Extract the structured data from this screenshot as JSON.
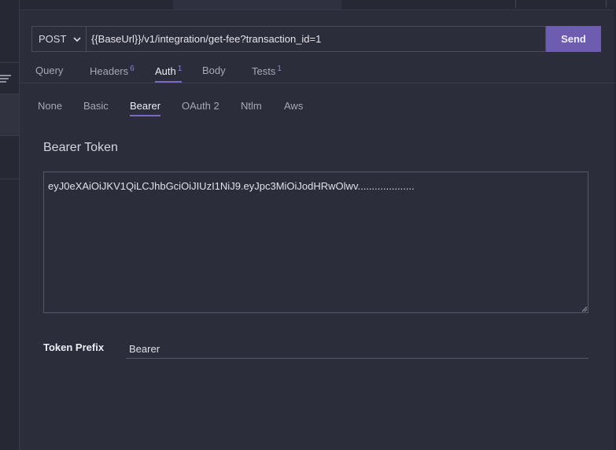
{
  "request": {
    "method": "POST",
    "url": "{{BaseUrl}}/v1/integration/get-fee?transaction_id=1",
    "send_label": "Send"
  },
  "tabs": [
    {
      "label": "Query",
      "count": ""
    },
    {
      "label": "Headers",
      "count": "6"
    },
    {
      "label": "Auth",
      "count": "1"
    },
    {
      "label": "Body",
      "count": ""
    },
    {
      "label": "Tests",
      "count": "1"
    }
  ],
  "active_tab": "Auth",
  "auth_types": [
    "None",
    "Basic",
    "Bearer",
    "OAuth 2",
    "Ntlm",
    "Aws"
  ],
  "active_auth_type": "Bearer",
  "bearer": {
    "title": "Bearer Token",
    "token": "eyJ0eXAiOiJKV1QiLCJhbGciOiJIUzI1NiJ9.eyJpc3MiOiJodHRwOlwv....................",
    "prefix_label": "Token Prefix",
    "prefix_value": "Bearer"
  },
  "colors": {
    "accent": "#7b68c7",
    "send_button": "#6e5cb0",
    "background": "#2b2d3a"
  }
}
